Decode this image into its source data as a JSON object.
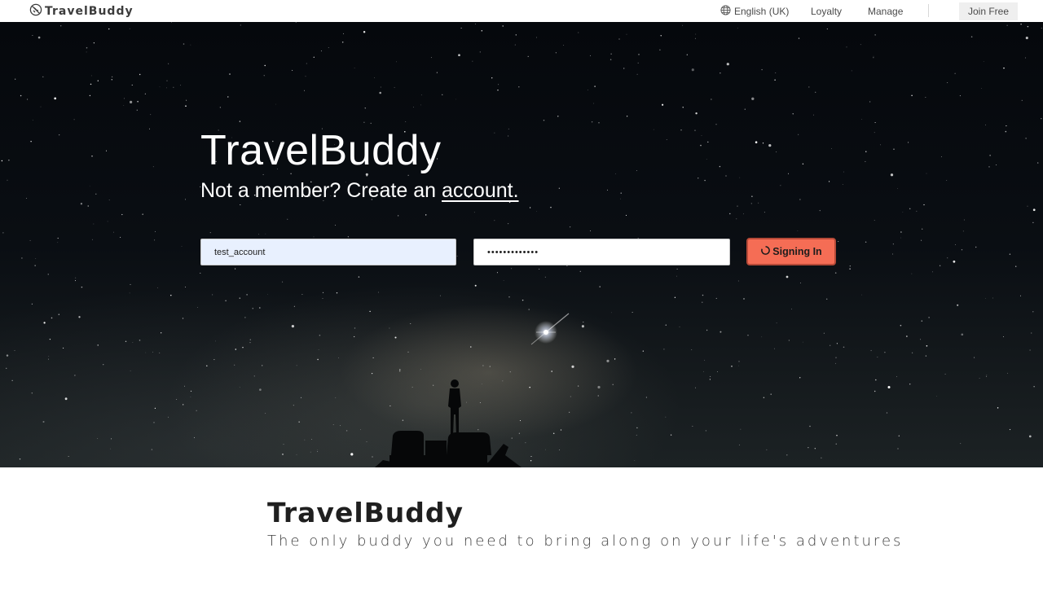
{
  "nav": {
    "brand": "TravelBuddy",
    "language": "English (UK)",
    "loyalty": "Loyalty",
    "manage": "Manage",
    "join": "Join Free"
  },
  "hero": {
    "title": "TravelBuddy",
    "subtitle_prefix": "Not a member? Create an",
    "subtitle_link": "account.",
    "username_value": "test_account",
    "password_value": "•••••••••••••",
    "signin_label": "Signing In"
  },
  "about": {
    "title": "TravelBuddy",
    "tagline": "The only buddy you need to bring along on your life's adventures"
  },
  "colors": {
    "accent": "#f56d55",
    "username_bg": "#e8f0fe"
  }
}
